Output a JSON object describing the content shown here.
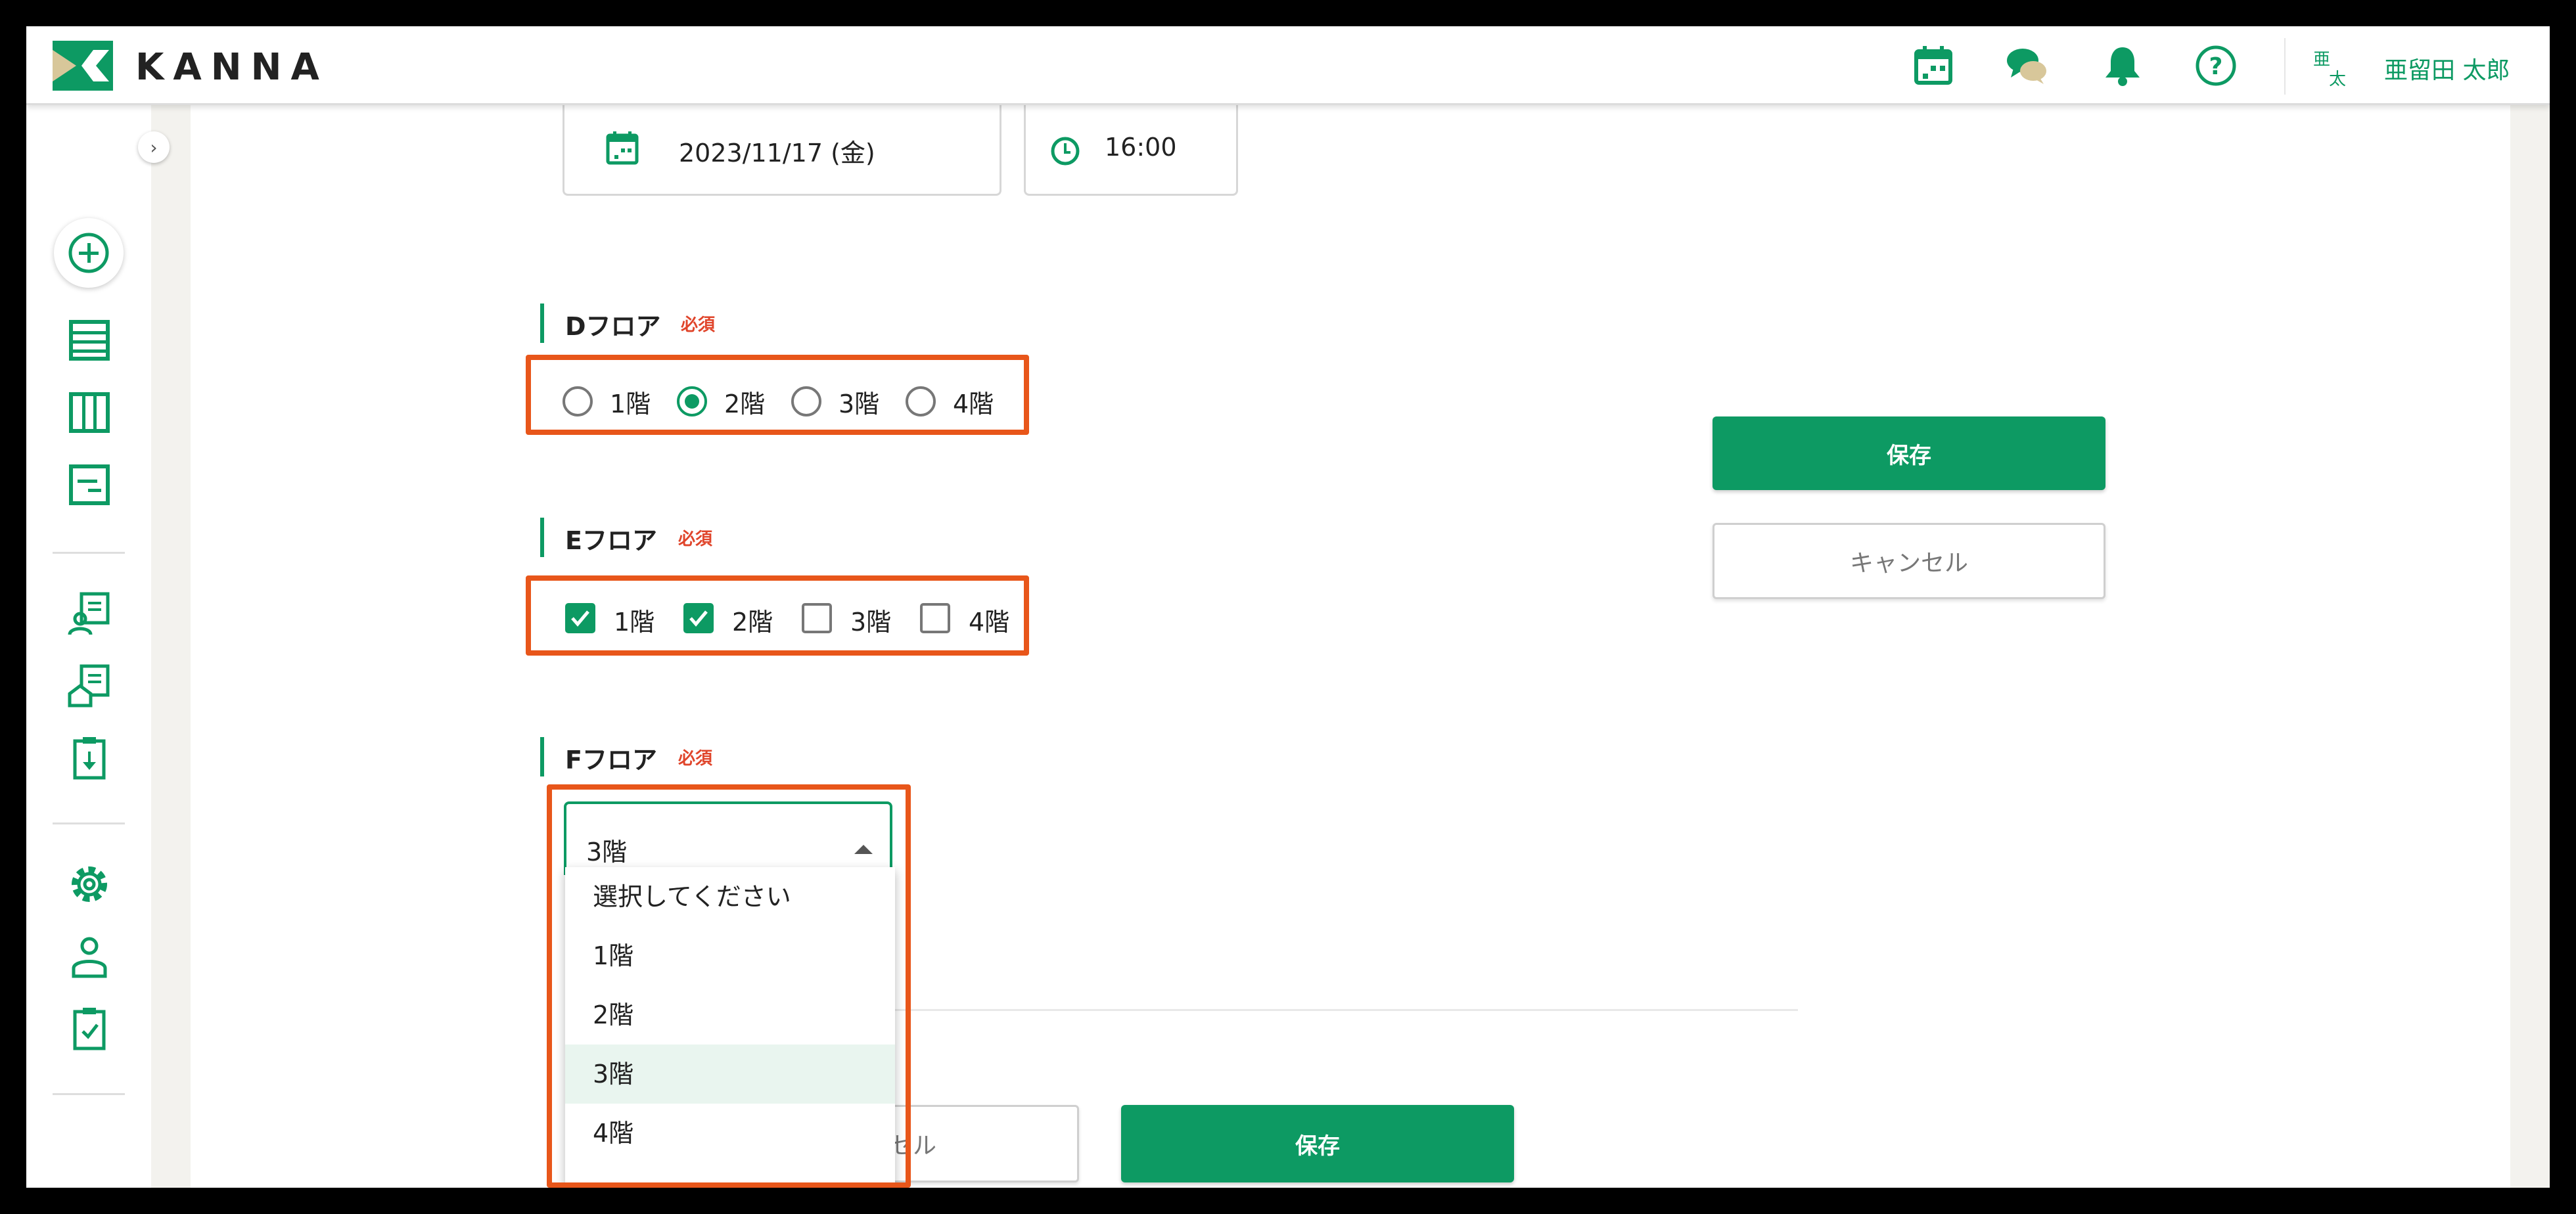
{
  "colors": {
    "accent": "#0d9a63",
    "required": "#e0452b",
    "highlight": "#e8561a"
  },
  "header": {
    "logo_text": "KANNA",
    "icons": [
      "calendar-icon",
      "chat-icon",
      "bell-icon",
      "help-icon"
    ],
    "avatar": {
      "top": "亜",
      "bottom": "太"
    },
    "user_name": "亜留田 太郎"
  },
  "sidebar": {
    "icons": [
      "add-icon",
      "list-icon",
      "board-icon",
      "form-icon",
      "report-icon",
      "building-report-icon",
      "download-clipboard-icon",
      "gear-icon",
      "user-icon",
      "check-clipboard-icon"
    ]
  },
  "form": {
    "date": "2023/11/17 (金)",
    "time": "16:00",
    "required_label": "必須",
    "d_floor": {
      "title": "Dフロア",
      "options": [
        "1階",
        "2階",
        "3階",
        "4階"
      ],
      "selected": "2階"
    },
    "e_floor": {
      "title": "Eフロア",
      "options": [
        "1階",
        "2階",
        "3階",
        "4階"
      ],
      "checked": [
        "1階",
        "2階"
      ]
    },
    "f_floor": {
      "title": "Fフロア",
      "value": "3階",
      "options": [
        "選択してください",
        "1階",
        "2階",
        "3階",
        "4階"
      ]
    }
  },
  "side_actions": {
    "save": "保存",
    "cancel": "キャンセル"
  },
  "bottom_actions": {
    "cancel_partial": "セル",
    "save": "保存"
  }
}
